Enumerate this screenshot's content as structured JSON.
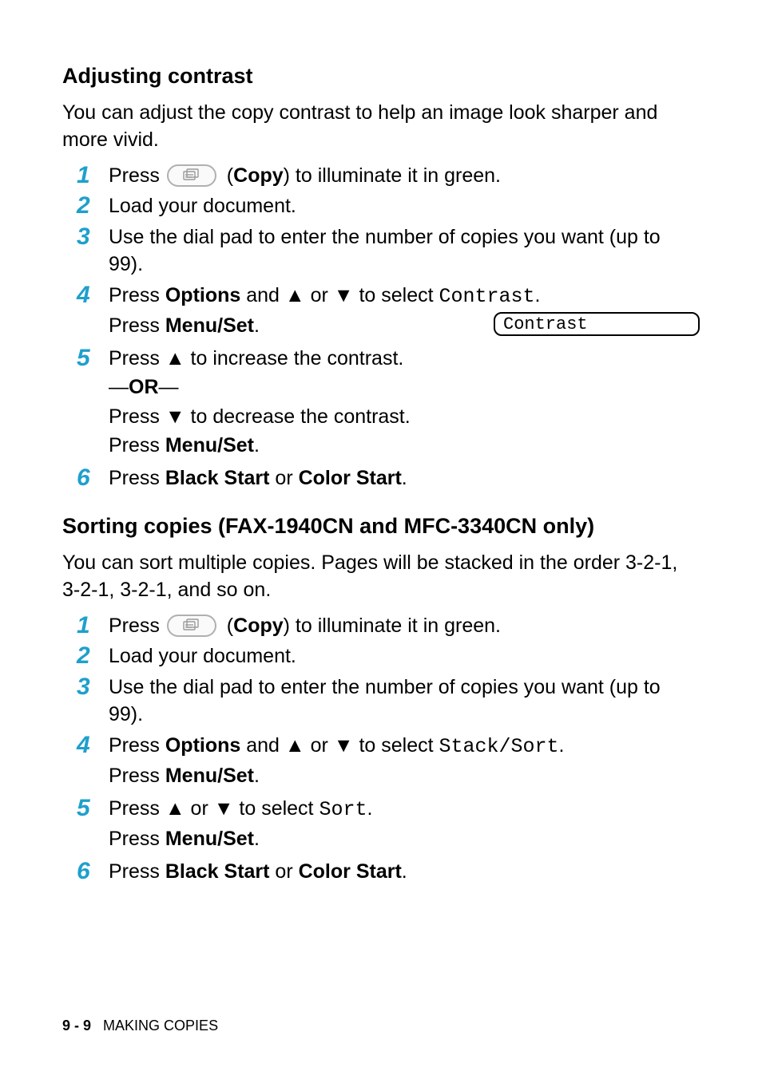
{
  "section1": {
    "heading": "Adjusting contrast",
    "intro": "You can adjust the copy contrast to help an image look sharper and more vivid.",
    "steps": {
      "s1": {
        "t1": "Press ",
        "t2": " (",
        "copy": "Copy",
        "t3": ") to illuminate it in green."
      },
      "s2": {
        "t1": "Load your document."
      },
      "s3": {
        "t1": "Use the dial pad to enter the number of copies you want (up to 99)."
      },
      "s4": {
        "t1": "Press ",
        "options": "Options",
        "t2": " and ▲ or ▼ to select ",
        "mono": "Contrast",
        "t3": ".",
        "t4": "Press ",
        "menuset": "Menu/Set",
        "t5": ".",
        "lcd": "Contrast"
      },
      "s5": {
        "t1": "Press ▲ to increase the contrast.",
        "or1": "—",
        "or2": "OR",
        "or3": "—",
        "t2": "Press ▼ to decrease the contrast.",
        "t3": "Press ",
        "menuset": "Menu/Set",
        "t4": "."
      },
      "s6": {
        "t1": "Press ",
        "bs": "Black Start",
        "t2": " or ",
        "cs": "Color Start",
        "t3": "."
      }
    }
  },
  "section2": {
    "heading": "Sorting copies (FAX-1940CN and MFC-3340CN only)",
    "intro": "You can sort multiple copies. Pages will be stacked in the order 3-2-1, 3-2-1, 3-2-1, and so on.",
    "steps": {
      "s1": {
        "t1": "Press ",
        "t2": " (",
        "copy": "Copy",
        "t3": ") to illuminate it in green."
      },
      "s2": {
        "t1": "Load your document."
      },
      "s3": {
        "t1": "Use the dial pad to enter the number of copies you want (up to 99)."
      },
      "s4": {
        "t1": "Press ",
        "options": "Options",
        "t2": " and ▲ or ▼ to select ",
        "mono": "Stack/Sort",
        "t3": ".",
        "t4": "Press ",
        "menuset": "Menu/Set",
        "t5": "."
      },
      "s5": {
        "t1": "Press ▲ or ▼ to select ",
        "mono": "Sort",
        "t2": ".",
        "t3": "Press ",
        "menuset": "Menu/Set",
        "t4": "."
      },
      "s6": {
        "t1": "Press ",
        "bs": "Black Start",
        "t2": " or ",
        "cs": "Color Start",
        "t3": "."
      }
    }
  },
  "nums": {
    "n1": "1",
    "n2": "2",
    "n3": "3",
    "n4": "4",
    "n5": "5",
    "n6": "6"
  },
  "footer": {
    "page": "9 - 9",
    "title": "MAKING COPIES"
  }
}
